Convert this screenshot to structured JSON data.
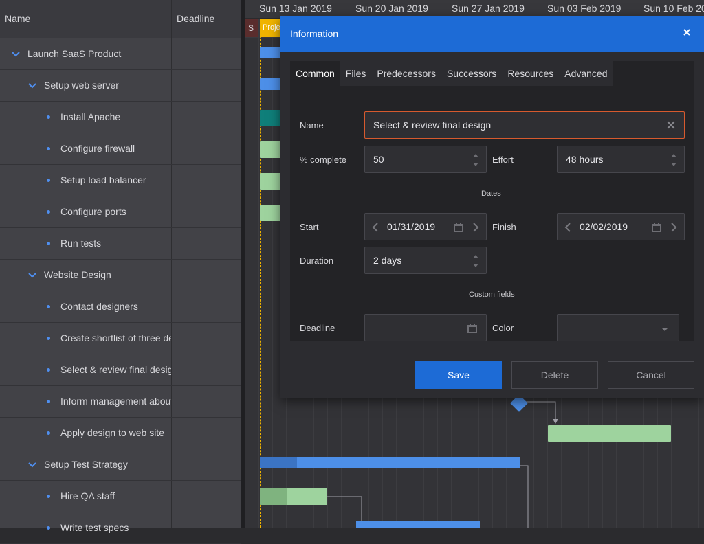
{
  "grid": {
    "columns": {
      "name": "Name",
      "deadline": "Deadline"
    },
    "rows": [
      {
        "label": "Launch SaaS Product",
        "level": 0,
        "type": "parent"
      },
      {
        "label": "Setup web server",
        "level": 1,
        "type": "parent"
      },
      {
        "label": "Install Apache",
        "level": 2,
        "type": "leaf"
      },
      {
        "label": "Configure firewall",
        "level": 2,
        "type": "leaf"
      },
      {
        "label": "Setup load balancer",
        "level": 2,
        "type": "leaf"
      },
      {
        "label": "Configure ports",
        "level": 2,
        "type": "leaf"
      },
      {
        "label": "Run tests",
        "level": 2,
        "type": "leaf"
      },
      {
        "label": "Website Design",
        "level": 1,
        "type": "parent"
      },
      {
        "label": "Contact designers",
        "level": 2,
        "type": "leaf"
      },
      {
        "label": "Create shortlist of three de",
        "level": 2,
        "type": "leaf"
      },
      {
        "label": "Select & review final desigr",
        "level": 2,
        "type": "leaf"
      },
      {
        "label": "Inform management about",
        "level": 2,
        "type": "leaf"
      },
      {
        "label": "Apply design to web site",
        "level": 2,
        "type": "leaf"
      },
      {
        "label": "Setup Test Strategy",
        "level": 1,
        "type": "parent"
      },
      {
        "label": "Hire QA staff",
        "level": 2,
        "type": "leaf"
      },
      {
        "label": "Write test specs",
        "level": 2,
        "type": "leaf"
      }
    ]
  },
  "timeaxis": {
    "weeks": [
      "Sun 13 Jan 2019",
      "Sun 20 Jan 2019",
      "Sun 27 Jan 2019",
      "Sun 03 Feb 2019",
      "Sun 10 Feb 20"
    ],
    "s_label": "S",
    "project_label": "Proje"
  },
  "dialog": {
    "title": "Information",
    "tabs": [
      "Common",
      "Files",
      "Predecessors",
      "Successors",
      "Resources",
      "Advanced"
    ],
    "active_tab": "Common",
    "name_label": "Name",
    "name_value": "Select & review final design",
    "percent_label": "% complete",
    "percent_value": "50",
    "effort_label": "Effort",
    "effort_value": "48 hours",
    "dates_section": "Dates",
    "start_label": "Start",
    "start_value": "01/31/2019",
    "finish_label": "Finish",
    "finish_value": "02/02/2019",
    "duration_label": "Duration",
    "duration_value": "2 days",
    "custom_section": "Custom fields",
    "deadline_label": "Deadline",
    "deadline_value": "",
    "color_label": "Color",
    "color_value": "",
    "buttons": {
      "save": "Save",
      "delete": "Delete",
      "cancel": "Cancel"
    }
  },
  "colors": {
    "accent": "#1d6bd6",
    "focus_border": "#d75a2e",
    "today_line": "#f0b400",
    "task_bar": "#4d8fe8",
    "leaf_bar": "#9ed39e"
  }
}
